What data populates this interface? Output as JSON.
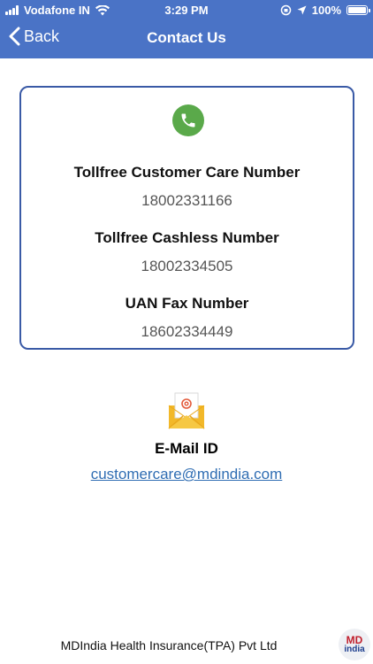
{
  "status_bar": {
    "carrier": "Vodafone IN",
    "time": "3:29 PM",
    "battery": "100%"
  },
  "nav": {
    "back_label": "Back",
    "title": "Contact Us"
  },
  "contacts": [
    {
      "label": "Tollfree Customer Care Number",
      "value": "18002331166"
    },
    {
      "label": "Tollfree Cashless Number",
      "value": "18002334505"
    },
    {
      "label": "UAN Fax Number",
      "value": "18602334449"
    }
  ],
  "email": {
    "label": "E-Mail ID",
    "address": "customercare@mdindia.com"
  },
  "footer": {
    "company": "MDIndia Health Insurance(TPA) Pvt Ltd",
    "logo_top": "MD",
    "logo_bottom": "india"
  },
  "colors": {
    "header": "#4a73c6",
    "card_border": "#3a5aa6",
    "phone_icon": "#5aa94a",
    "link": "#2f6db3"
  }
}
